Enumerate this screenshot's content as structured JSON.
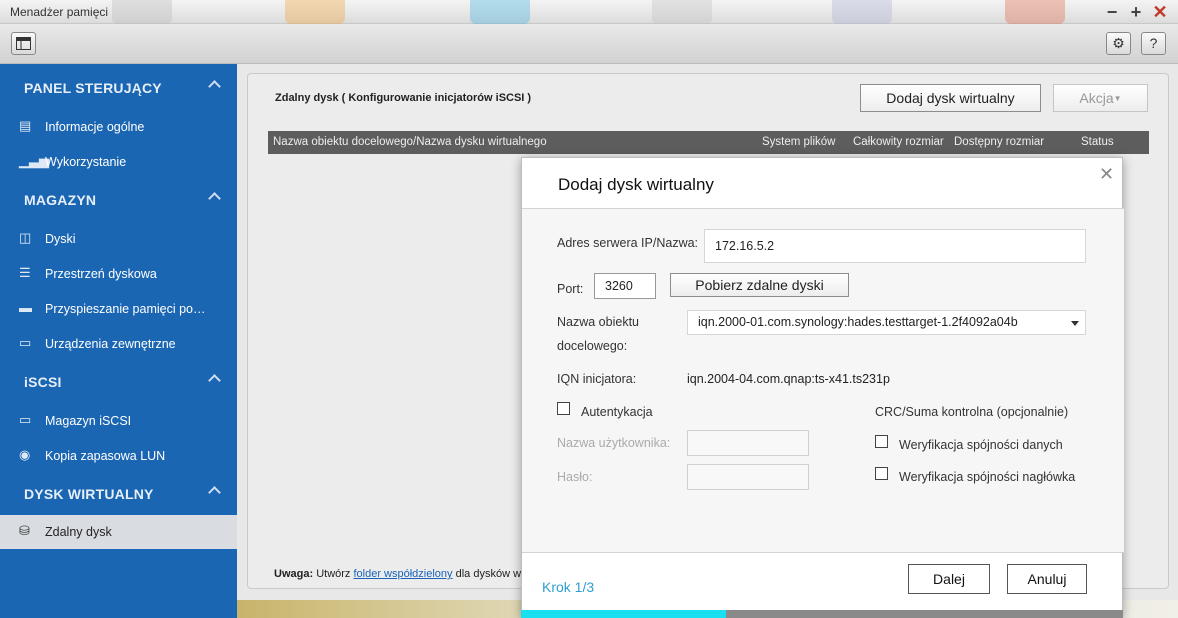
{
  "window": {
    "title": "Menadżer pamięci",
    "minimize_icon": "minus-icon",
    "maximize_icon": "plus-icon",
    "close_icon": "close-icon"
  },
  "toolbar": {
    "layout_icon": "panel-icon",
    "settings_icon": "gear-icon",
    "help_label": "?"
  },
  "sidebar": {
    "sections": [
      {
        "label": "PANEL STERUJĄCY",
        "items": [
          {
            "label": "Informacje ogólne",
            "icon": "info-icon"
          },
          {
            "label": "Wykorzystanie",
            "icon": "bar-chart-icon"
          }
        ]
      },
      {
        "label": "MAGAZYN",
        "items": [
          {
            "label": "Dyski",
            "icon": "disk-icon"
          },
          {
            "label": "Przestrzeń dyskowa",
            "icon": "storage-icon"
          },
          {
            "label": "Przyspieszanie pamięci podręcznej",
            "icon": "cache-icon"
          },
          {
            "label": "Urządzenia zewnętrzne",
            "icon": "external-device-icon"
          }
        ]
      },
      {
        "label": "iSCSI",
        "items": [
          {
            "label": "Magazyn iSCSI",
            "icon": "iscsi-storage-icon"
          },
          {
            "label": "Kopia zapasowa LUN",
            "icon": "backup-icon"
          }
        ]
      },
      {
        "label": "DYSK WIRTUALNY",
        "items": [
          {
            "label": "Zdalny dysk",
            "icon": "remote-disk-icon",
            "active": true
          }
        ]
      }
    ]
  },
  "main": {
    "title": "Zdalny dysk ( Konfigurowanie inicjatorów iSCSI )",
    "add_button": "Dodaj dysk wirtualny",
    "action_button": "Akcja",
    "table_headers": [
      "Nazwa obiektu docelowego/Nazwa dysku wirtualnego",
      "System plików",
      "Całkowity rozmiar",
      "Dostępny rozmiar",
      "Status"
    ],
    "note_prefix": "Uwaga:",
    "note_text": "Utwórz",
    "note_link": "folder współdzielony",
    "note_suffix": "dla dysków w"
  },
  "dialog": {
    "title": "Dodaj dysk wirtualny",
    "close_icon": "close-icon",
    "server_label": "Adres serwera IP/Nazwa:",
    "server_value": "172.16.5.2",
    "port_label": "Port:",
    "port_value": "3260",
    "fetch_button": "Pobierz zdalne dyski",
    "target_label_1": "Nazwa obiektu",
    "target_label_2": "docelowego:",
    "target_value": "iqn.2000-01.com.synology:hades.testtarget-1.2f4092a04b",
    "iqn_label": "IQN inicjatora:",
    "iqn_value": "iqn.2004-04.com.qnap:ts-x41.ts231p",
    "auth_label": "Autentykacja",
    "auth_checked": false,
    "username_label": "Nazwa użytkownika:",
    "username_value": "",
    "password_label": "Hasło:",
    "password_value": "",
    "crc_label": "CRC/Suma kontrolna (opcjonalnie)",
    "data_digest_label": "Weryfikacja spójności danych",
    "data_digest_checked": false,
    "header_digest_label": "Weryfikacja spójności nagłówka",
    "header_digest_checked": false,
    "step_label": "Krok 1/3",
    "next_button": "Dalej",
    "cancel_button": "Anuluj",
    "progress_fraction": 0.34
  }
}
